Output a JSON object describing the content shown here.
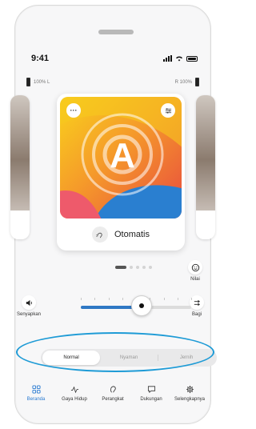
{
  "status_bar": {
    "time": "9:41"
  },
  "hearing_aids": {
    "left": {
      "label": "100% L",
      "level_percent": 100
    },
    "right": {
      "label": "R  100%",
      "level_percent": 100
    }
  },
  "program_card": {
    "letter": "A",
    "name": "Otomatis",
    "more_icon": "ellipsis-icon",
    "settings_icon": "sliders-icon",
    "program_icon": "hearing-icon"
  },
  "pager": {
    "active_index": 0,
    "count": 5
  },
  "side_actions": {
    "rate": {
      "label": "Nilai",
      "icon": "smiley-icon"
    },
    "mute": {
      "label": "Senyapkan",
      "icon": "speaker-icon"
    },
    "share": {
      "label": "Bagi",
      "icon": "split-icon"
    }
  },
  "volume": {
    "level_fraction": 0.55
  },
  "sound_modes": {
    "options": [
      "Normal",
      "Nyaman",
      "Jernih"
    ],
    "selected": "Normal"
  },
  "tab_bar": {
    "items": [
      {
        "label": "Beranda",
        "icon": "grid-icon",
        "active": true
      },
      {
        "label": "Gaya Hidup",
        "icon": "activity-icon",
        "active": false
      },
      {
        "label": "Perangkat",
        "icon": "hearing-aid-icon",
        "active": false
      },
      {
        "label": "Dukungan",
        "icon": "chat-icon",
        "active": false
      },
      {
        "label": "Selengkapnya",
        "icon": "gear-icon",
        "active": false
      }
    ]
  },
  "colors": {
    "accent": "#2b7bd1",
    "annotation": "#1e9bd6",
    "card_gradient": [
      "#f6c21f",
      "#f07c3c",
      "#e43a4e"
    ],
    "blue_blob": "#2a7fd0"
  }
}
